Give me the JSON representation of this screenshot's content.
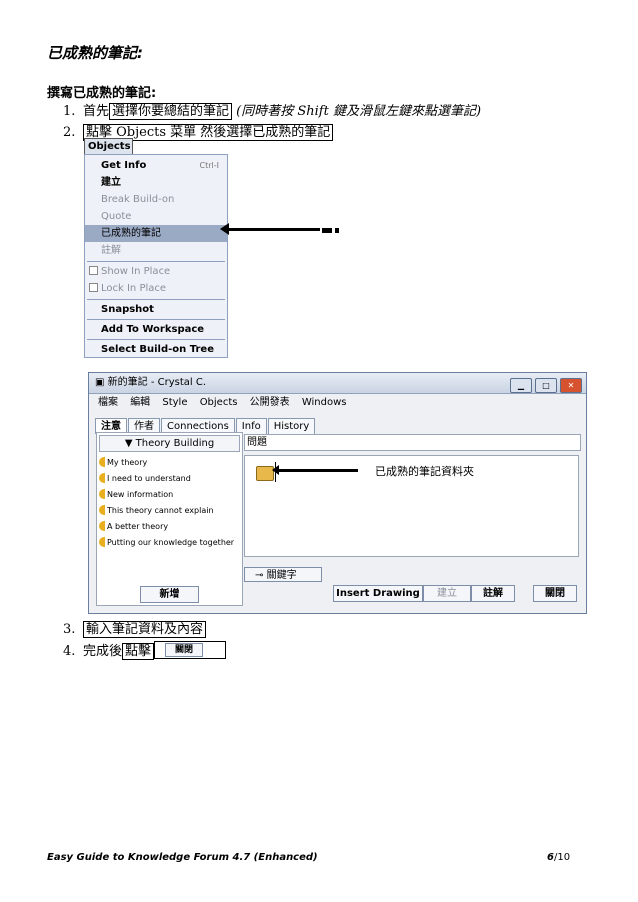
{
  "title": "已成熟的筆記:",
  "subheading": "撰寫已成熟的筆記:",
  "steps": [
    {
      "num": "1.",
      "text_a": "首先",
      "text_boxed": "選擇你要總結的筆記",
      "text_note": "(同時著按 Shift 鍵及滑鼠左鍵來點選筆記)"
    },
    {
      "num": "2.",
      "text_boxed": "點擊 Objects 菜單 然後選擇已成熟的筆記"
    },
    {
      "num": "3.",
      "text_boxed": "輸入筆記資料及內容"
    },
    {
      "num": "4.",
      "text_a": "完成後",
      "text_boxed": "點擊",
      "button": "關閉"
    }
  ],
  "objects_menu": {
    "title": "Objects",
    "items": [
      {
        "label": "Get Info",
        "shortcut": "Ctrl-I",
        "state": "bold"
      },
      {
        "label": "建立",
        "state": "bold"
      },
      {
        "label": "Break Build-on",
        "state": "disabled"
      },
      {
        "label": "Quote",
        "state": "disabled"
      },
      {
        "label": "已成熟的筆記",
        "state": "selected"
      },
      {
        "label": "註解",
        "state": "disabled"
      },
      {
        "label": "Show In Place",
        "state": "disabled"
      },
      {
        "label": "Lock In Place",
        "state": "disabled"
      },
      {
        "label": "Snapshot",
        "state": "bold"
      },
      {
        "label": "Add To Workspace",
        "state": "bold"
      },
      {
        "label": "Select Build-on Tree",
        "state": "bold"
      }
    ]
  },
  "window": {
    "title": "新的筆記 - Crystal C.",
    "menubar": [
      "檔案",
      "編輯",
      "Style",
      "Objects",
      "公開發表",
      "Windows"
    ],
    "tabs": [
      "注意",
      "作者",
      "Connections",
      "Info",
      "History"
    ],
    "theory_dropdown": "▼ Theory Building",
    "theory_items": [
      "My theory",
      "I need to understand",
      "New information",
      "This theory cannot explain",
      "A better theory",
      "Putting our knowledge together"
    ],
    "new_button": "新增",
    "problem_label": "問題",
    "folder_label": "已成熟的筆記資料夾",
    "keyword_button": "關鍵字",
    "insert_drawing": "Insert Drawing",
    "build_button": "建立",
    "annotate_button": "註解",
    "close_button": "關閉"
  },
  "footer": {
    "left": "Easy Guide to Knowledge Forum 4.7 (Enhanced)",
    "page": "6",
    "total": "/10"
  }
}
